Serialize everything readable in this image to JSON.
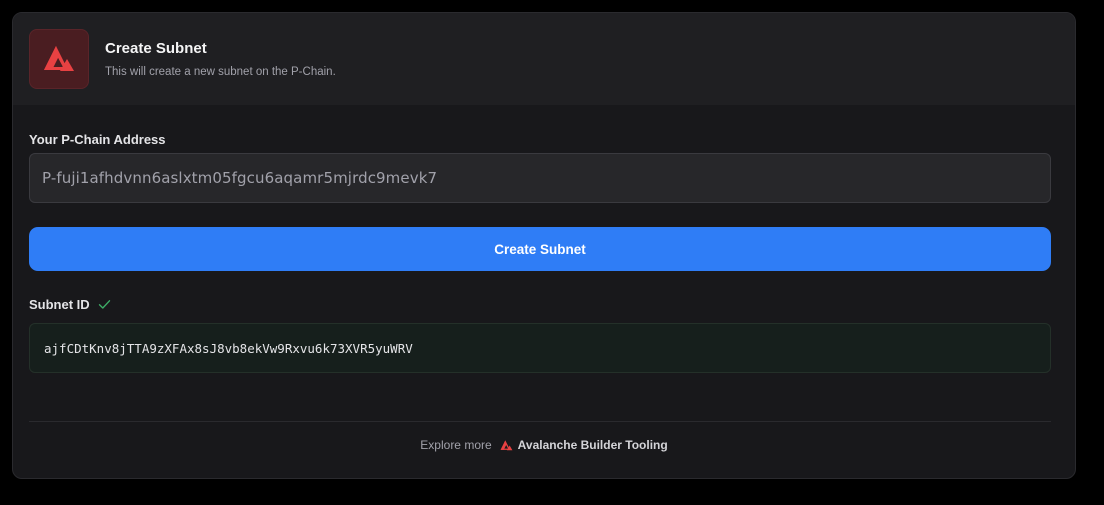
{
  "header": {
    "title": "Create Subnet",
    "subtitle": "This will create a new subnet on the P-Chain.",
    "logo_icon": "avalanche-logo-icon"
  },
  "address": {
    "label": "Your P-Chain Address",
    "value": "P-fuji1afhdvnn6aslxtm05fgcu6aqamr5mjrdc9mevk7"
  },
  "create_button": {
    "label": "Create Subnet"
  },
  "subnet": {
    "label": "Subnet ID",
    "status_icon": "check-icon",
    "value": "ajfCDtKnv8jTTA9zXFAx8sJ8vb8ekVw9Rxvu6k73XVR5yuWRV"
  },
  "footer": {
    "explore_text": "Explore more",
    "link_text": "Avalanche Builder Tooling"
  },
  "colors": {
    "accent_blue": "#2f7df6",
    "avalanche_red": "#e84142",
    "success_green": "#4ade80"
  }
}
